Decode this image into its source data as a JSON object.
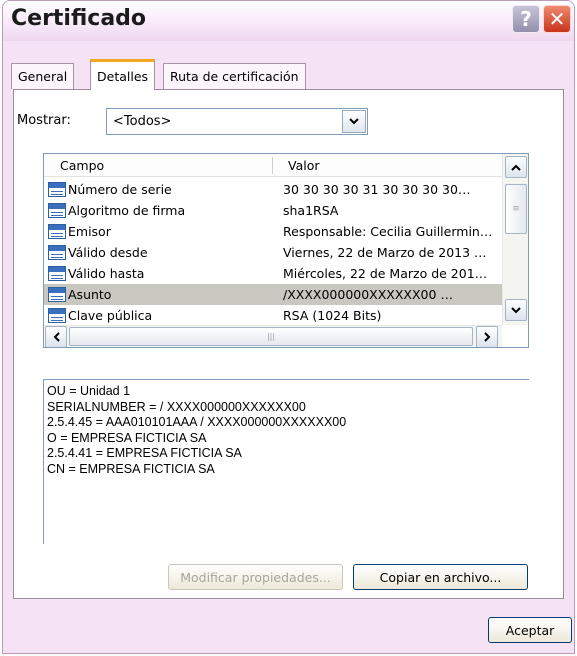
{
  "window": {
    "title": "Certificado"
  },
  "titlebar": {
    "help_glyph": "?",
    "close_glyph": "✕"
  },
  "tabs": [
    {
      "label": "General"
    },
    {
      "label": "Detalles"
    },
    {
      "label": "Ruta de certificación"
    }
  ],
  "show": {
    "label": "Mostrar:",
    "value": "<Todos>"
  },
  "list": {
    "columns": [
      "Campo",
      "Valor"
    ],
    "rows": [
      {
        "field": "Número de serie",
        "value": "30 30 30 30 31 30 30 30 30…"
      },
      {
        "field": "Algoritmo de firma",
        "value": "sha1RSA"
      },
      {
        "field": "Emisor",
        "value": "Responsable: Cecilia Guillermin…"
      },
      {
        "field": "Válido desde",
        "value": "Viernes, 22 de Marzo de 2013 …"
      },
      {
        "field": "Válido hasta",
        "value": "Miércoles, 22 de Marzo de 201…"
      },
      {
        "field": "Asunto",
        "value": "/XXXX000000XXXXXX00   …"
      },
      {
        "field": "Clave pública",
        "value": "RSA (1024 Bits)"
      }
    ],
    "selected_row": "Asunto"
  },
  "detail_lines": [
    "OU = Unidad 1",
    "SERIALNUMBER = / XXXX000000XXXXXX00",
    "2.5.4.45 = AAA010101AAA / XXXX000000XXXXXX00",
    "O = EMPRESA FICTICIA SA",
    "2.5.4.41 = EMPRESA FICTICIA SA",
    "CN = EMPRESA FICTICIA SA"
  ],
  "buttons": {
    "edit_properties": "Modificar propiedades...",
    "copy_to_file": "Copiar en archivo...",
    "ok": "Aceptar"
  },
  "colors": {
    "window_bg": "#f5e3f5",
    "active_tab_accent": "#f5a623",
    "selected_row": "#c8c8c0",
    "close_button": "#c8341c"
  }
}
